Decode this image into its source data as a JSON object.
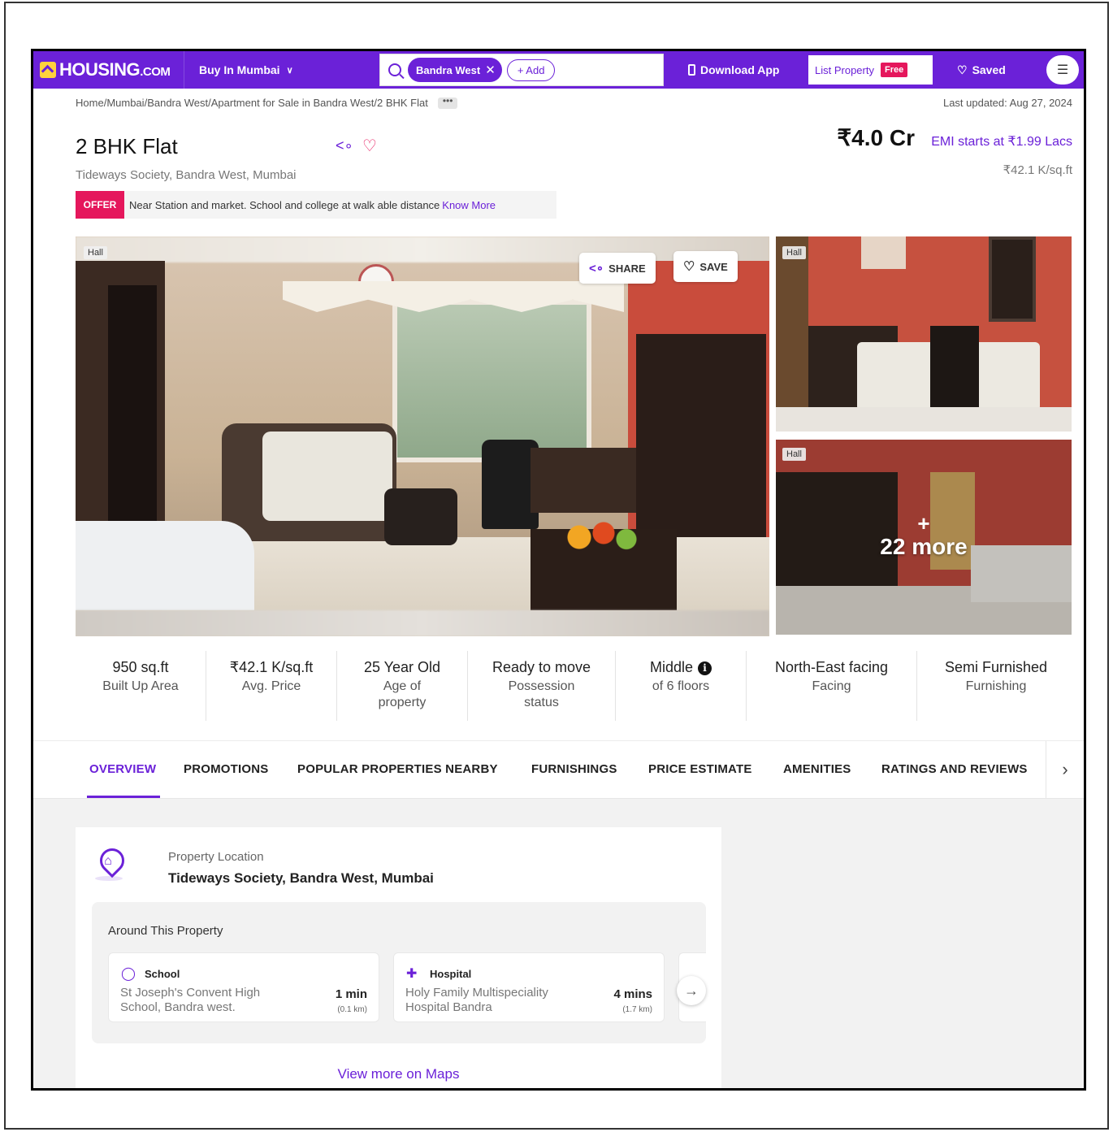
{
  "nav": {
    "logo_main": "HOUSING",
    "logo_suffix": ".COM",
    "buy_label": "Buy In Mumbai",
    "search_chip": "Bandra West",
    "search_add": "+ Add",
    "download_app": "Download App",
    "list_property": "List Property",
    "free_badge": "Free",
    "saved": "Saved"
  },
  "breadcrumb": {
    "items": [
      "Home",
      "Mumbai",
      "Bandra West",
      "Apartment for Sale in Bandra West",
      "2 BHK Flat"
    ],
    "separator": " / ",
    "more": "•••"
  },
  "last_updated": "Last updated: Aug 27, 2024",
  "listing": {
    "title": "2 BHK Flat",
    "location": "Tideways Society, Bandra West, Mumbai",
    "price": "₹4.0 Cr",
    "emi": "EMI starts at ₹1.99 Lacs",
    "price_per_sqft": "₹42.1 K/sq.ft"
  },
  "offer": {
    "tag": "OFFER",
    "text": "Near Station and market. School and college at walk able distance",
    "link": "Know More"
  },
  "gallery": {
    "main_tag": "Hall",
    "share": "SHARE",
    "save": "SAVE",
    "side1_tag": "Hall",
    "side2_tag": "Hall",
    "more_plus": "+",
    "more_text": "22 more"
  },
  "stats": [
    {
      "value": "950 sq.ft",
      "label": "Built Up Area"
    },
    {
      "value": "₹42.1 K/sq.ft",
      "label": "Avg. Price"
    },
    {
      "value": "25 Year Old",
      "label": "Age of property"
    },
    {
      "value": "Ready to move",
      "label": "Possession status"
    },
    {
      "value": "Middle",
      "label": "of 6 floors"
    },
    {
      "value": "North-East facing",
      "label": "Facing"
    },
    {
      "value": "Semi Furnished",
      "label": "Furnishing"
    }
  ],
  "tabs": [
    "OVERVIEW",
    "PROMOTIONS",
    "POPULAR PROPERTIES NEARBY",
    "FURNISHINGS",
    "PRICE ESTIMATE",
    "AMENITIES",
    "RATINGS AND REVIEWS"
  ],
  "active_tab": "OVERVIEW",
  "location_card": {
    "label": "Property Location",
    "value": "Tideways Society, Bandra West, Mumbai",
    "around_title": "Around This Property",
    "pois": [
      {
        "category": "School",
        "name": "St Joseph's Convent High School, Bandra west.",
        "time": "1 min",
        "distance": "(0.1 km)"
      },
      {
        "category": "Hospital",
        "name": "Holy Family Multispeciality Hospital Bandra",
        "time": "4 mins",
        "distance": "(1.7 km)"
      }
    ],
    "view_more": "View more on Maps"
  },
  "colors": {
    "brand": "#6b21d8",
    "offer": "#e5175c"
  }
}
